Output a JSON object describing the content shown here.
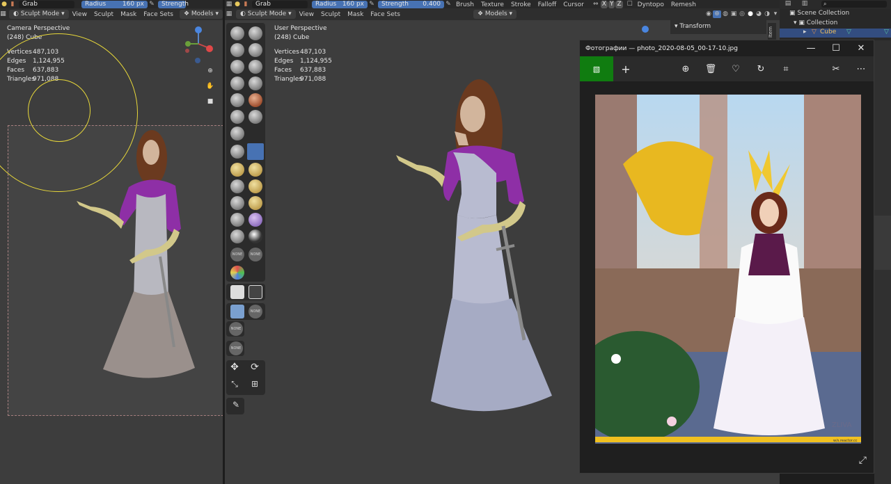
{
  "left_header": {
    "brush_name": "Grab",
    "radius_label": "Radius",
    "radius_value": "160 px",
    "strength_label": "Strength"
  },
  "left_menu": {
    "mode": "Sculpt Mode",
    "items": [
      "View",
      "Sculpt",
      "Mask",
      "Face Sets"
    ],
    "overlay": "Models"
  },
  "left_viewport": {
    "perspective": "Camera Perspective",
    "object": "(248) Cube",
    "stats": [
      {
        "label": "Vertices",
        "value": "487,103"
      },
      {
        "label": "Edges",
        "value": "1,124,955"
      },
      {
        "label": "Faces",
        "value": "637,883"
      },
      {
        "label": "Triangles",
        "value": "971,088"
      }
    ]
  },
  "main_header": {
    "brush_name": "Grab",
    "radius_label": "Radius",
    "radius_value": "160 px",
    "strength_label": "Strength",
    "strength_value": "0.400",
    "menus": [
      "Brush",
      "Texture",
      "Stroke",
      "Falloff",
      "Cursor"
    ],
    "axes": [
      "X",
      "Y",
      "Z"
    ],
    "dyntopo": "Dyntopo",
    "remesh": "Remesh"
  },
  "main_menu": {
    "mode": "Sculpt Mode",
    "items": [
      "View",
      "Sculpt",
      "Mask",
      "Face Sets"
    ],
    "overlay": "Models"
  },
  "main_viewport": {
    "perspective": "User Perspective",
    "object": "(248) Cube",
    "stats": [
      {
        "label": "Vertices",
        "value": "487,103"
      },
      {
        "label": "Edges",
        "value": "1,124,955"
      },
      {
        "label": "Faces",
        "value": "637,883"
      },
      {
        "label": "Triangles",
        "value": "971,088"
      }
    ],
    "none_label": "NONE"
  },
  "n_panel": {
    "section": "Transform",
    "tab": "Item"
  },
  "outliner": {
    "root": "Scene Collection",
    "collection": "Collection",
    "object": "Cube"
  },
  "photos": {
    "title": "Фотографии — photo_2020-08-05_00-17-10.jpg",
    "watermark": "ZLIVA",
    "source": "w/s.reactor.cc"
  },
  "colors": {
    "accent_blue": "#4772b3",
    "photos_green": "#107c10",
    "brush_circle": "#e8d83a"
  }
}
